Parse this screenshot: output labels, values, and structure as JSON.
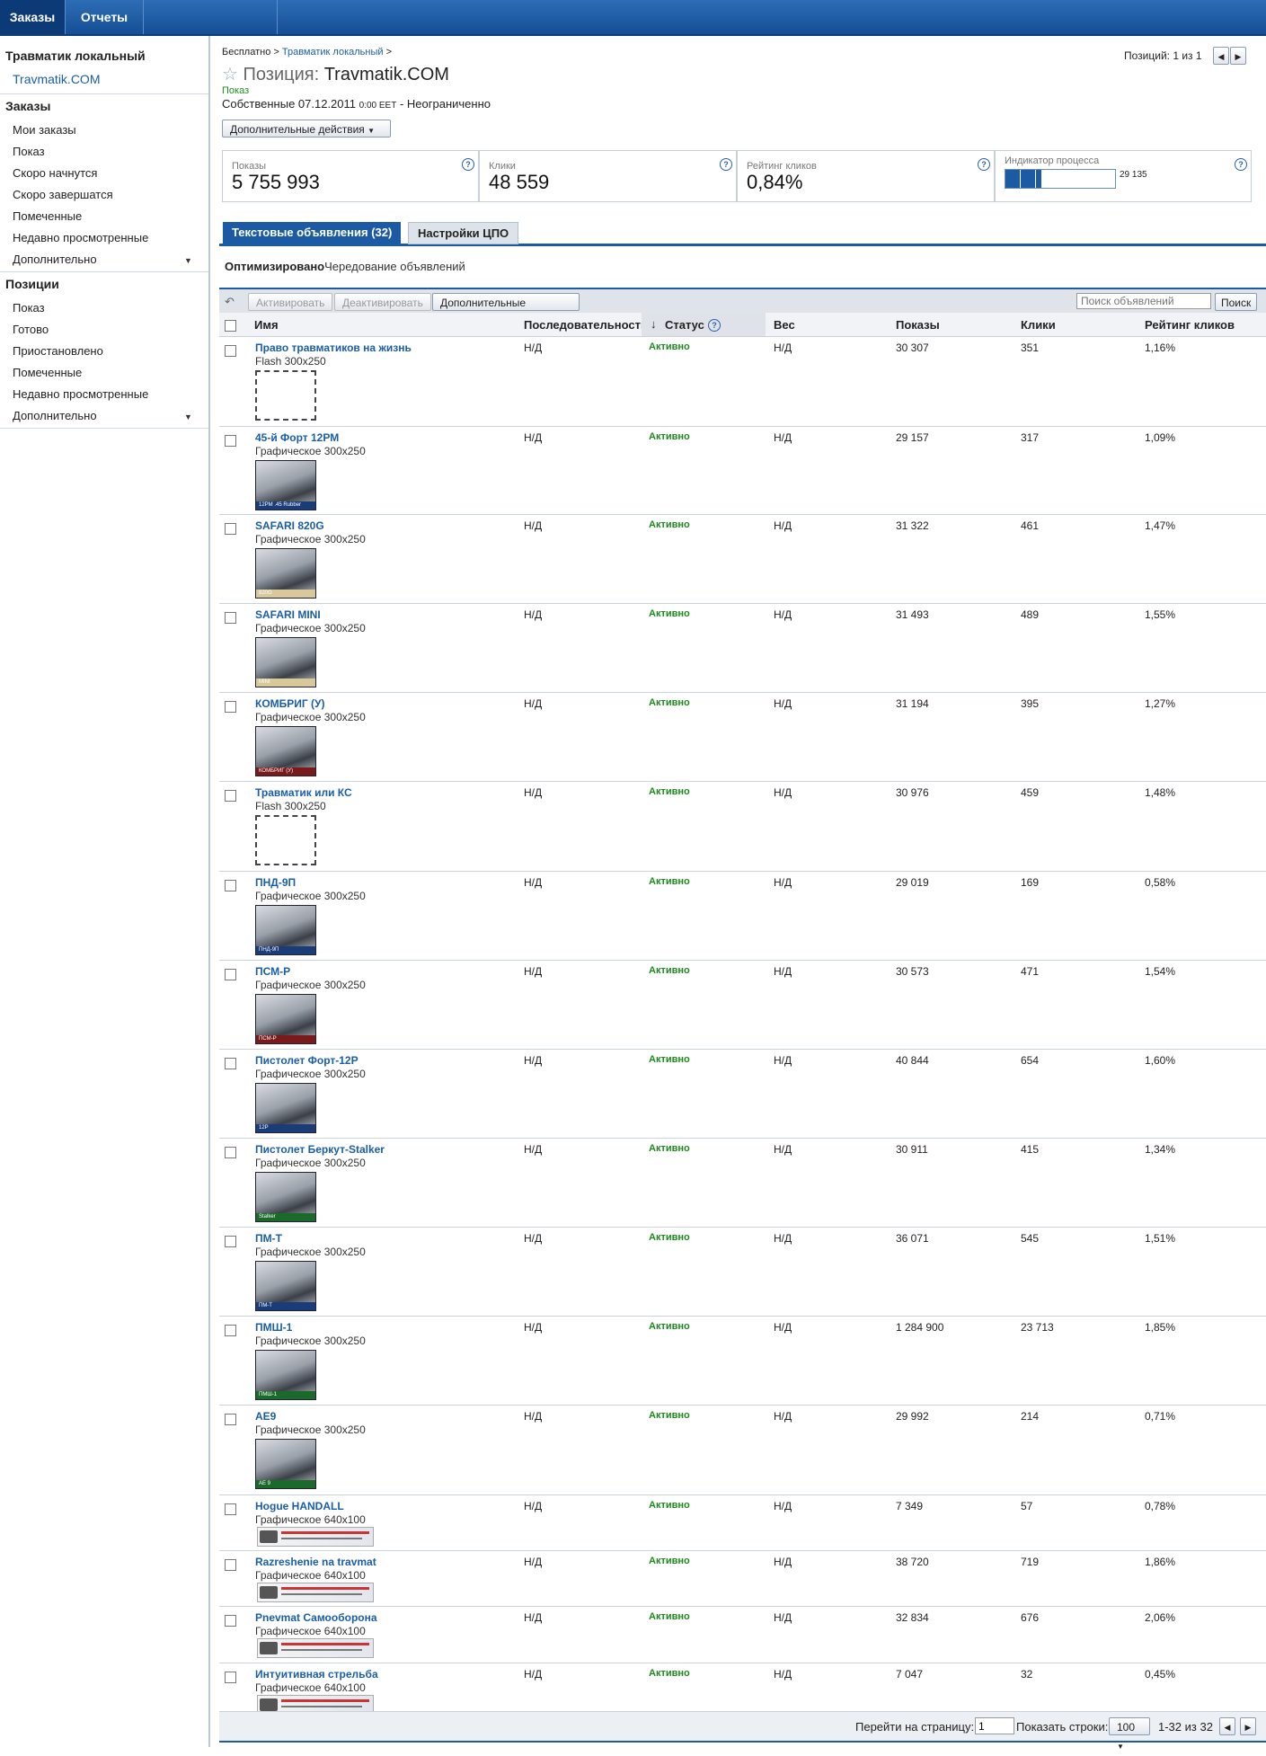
{
  "topnav": {
    "tabs": [
      "Заказы",
      "Отчеты"
    ]
  },
  "sidebar": {
    "account_title": "Травматик локальный",
    "account_link": "Travmatik.COM",
    "orders_header": "Заказы",
    "orders_items": [
      "Мои заказы",
      "Показ",
      "Скоро начнутся",
      "Скоро завершатся",
      "Помеченные",
      "Недавно просмотренные",
      "Дополнительно"
    ],
    "positions_header": "Позиции",
    "positions_items": [
      "Показ",
      "Готово",
      "Приостановлено",
      "Помеченные",
      "Недавно просмотренные",
      "Дополнительно"
    ]
  },
  "header": {
    "breadcrumb_1": "Бесплатно >",
    "breadcrumb_2": "Травматик локальный",
    "breadcrumb_sep": ">",
    "title_prefix": "Позиция:",
    "title_name": "Travmatik.COM",
    "status": "Показ",
    "dates_main": "Собственные 07.12.2011",
    "dates_time": "0:00 EET",
    "dates_end": "- Неограниченно",
    "more_actions": "Дополнительные действия",
    "pager_text": "Позиций: 1 из 1"
  },
  "stats": [
    {
      "label": "Показы",
      "value": "5 755 993"
    },
    {
      "label": "Клики",
      "value": "48 559"
    },
    {
      "label": "Рейтинг кликов",
      "value": "0,84%"
    },
    {
      "label": "Индикатор процесса",
      "value": "29 135",
      "progress": 0.33
    }
  ],
  "tabs": [
    "Текстовые объявления (32)",
    "Настройки ЦПО"
  ],
  "rotation": {
    "bold": "Оптимизировано",
    "rest": "Чередование объявлений"
  },
  "toolbar": {
    "activate": "Активировать",
    "deactivate": "Деактивировать",
    "more": "Дополнительные действия",
    "search_placeholder": "Поиск объявлений",
    "search_button": "Поиск"
  },
  "columns": [
    "Имя",
    "Последовательность",
    "Статус",
    "Вес",
    "Показы",
    "Клики",
    "Рейтинг кликов"
  ],
  "ads": [
    {
      "name": "Право травматиков на жизнь",
      "type": "Flash 300x250",
      "thumb": "dash",
      "caption": "",
      "seq": "Н/Д",
      "status": "Активно",
      "weight": "Н/Д",
      "impressions": "30 307",
      "clicks": "351",
      "ctr": "1,16%"
    },
    {
      "name": "45-й Форт 12РМ",
      "type": "Графическое 300x250",
      "thumb": "img",
      "caption": "12PM .45 Rubber",
      "strip": "#1a3d7a",
      "seq": "Н/Д",
      "status": "Активно",
      "weight": "Н/Д",
      "impressions": "29 157",
      "clicks": "317",
      "ctr": "1,09%"
    },
    {
      "name": "SAFARI 820G",
      "type": "Графическое 300x250",
      "thumb": "img",
      "caption": "820G",
      "strip": "#d9c99a",
      "seq": "Н/Д",
      "status": "Активно",
      "weight": "Н/Д",
      "impressions": "31 322",
      "clicks": "461",
      "ctr": "1,47%"
    },
    {
      "name": "SAFARI MINI",
      "type": "Графическое 300x250",
      "thumb": "img",
      "caption": "MINI",
      "strip": "#d9c99a",
      "seq": "Н/Д",
      "status": "Активно",
      "weight": "Н/Д",
      "impressions": "31 493",
      "clicks": "489",
      "ctr": "1,55%"
    },
    {
      "name": "КОМБРИГ (У)",
      "type": "Графическое 300x250",
      "thumb": "img",
      "caption": "КОМБРИГ (У)",
      "strip": "#7a1a1a",
      "seq": "Н/Д",
      "status": "Активно",
      "weight": "Н/Д",
      "impressions": "31 194",
      "clicks": "395",
      "ctr": "1,27%"
    },
    {
      "name": "Травматик или КС",
      "type": "Flash 300x250",
      "thumb": "dash",
      "caption": "",
      "seq": "Н/Д",
      "status": "Активно",
      "weight": "Н/Д",
      "impressions": "30 976",
      "clicks": "459",
      "ctr": "1,48%"
    },
    {
      "name": "ПНД-9П",
      "type": "Графическое 300x250",
      "thumb": "img",
      "caption": "ПНД-9П",
      "strip": "#1a3d7a",
      "seq": "Н/Д",
      "status": "Активно",
      "weight": "Н/Д",
      "impressions": "29 019",
      "clicks": "169",
      "ctr": "0,58%"
    },
    {
      "name": "ПСМ-Р",
      "type": "Графическое 300x250",
      "thumb": "img",
      "caption": "ПСМ-Р",
      "strip": "#7a1a1a",
      "seq": "Н/Д",
      "status": "Активно",
      "weight": "Н/Д",
      "impressions": "30 573",
      "clicks": "471",
      "ctr": "1,54%"
    },
    {
      "name": "Пистолет Форт-12Р",
      "type": "Графическое 300x250",
      "thumb": "img",
      "caption": "12P",
      "strip": "#1a3d7a",
      "seq": "Н/Д",
      "status": "Активно",
      "weight": "Н/Д",
      "impressions": "40 844",
      "clicks": "654",
      "ctr": "1,60%"
    },
    {
      "name": "Пистолет Беркут-Stalker",
      "type": "Графическое 300x250",
      "thumb": "img",
      "caption": "Stalker",
      "strip": "#1a6a2a",
      "seq": "Н/Д",
      "status": "Активно",
      "weight": "Н/Д",
      "impressions": "30 911",
      "clicks": "415",
      "ctr": "1,34%"
    },
    {
      "name": "ПМ-Т",
      "type": "Графическое 300x250",
      "thumb": "img",
      "caption": "ПМ-Т",
      "strip": "#1a3d7a",
      "seq": "Н/Д",
      "status": "Активно",
      "weight": "Н/Д",
      "impressions": "36 071",
      "clicks": "545",
      "ctr": "1,51%"
    },
    {
      "name": "ПМШ-1",
      "type": "Графическое 300x250",
      "thumb": "img",
      "caption": "ПМШ-1",
      "strip": "#1a6a2a",
      "seq": "Н/Д",
      "status": "Активно",
      "weight": "Н/Д",
      "impressions": "1 284 900",
      "clicks": "23 713",
      "ctr": "1,85%"
    },
    {
      "name": "AE9",
      "type": "Графическое 300x250",
      "thumb": "img",
      "caption": "AE 9",
      "strip": "#1a6a2a",
      "seq": "Н/Д",
      "status": "Активно",
      "weight": "Н/Д",
      "impressions": "29 992",
      "clicks": "214",
      "ctr": "0,71%"
    },
    {
      "name": "Hogue HANDALL",
      "type": "Графическое 640x100",
      "thumb": "banner",
      "caption": "",
      "seq": "Н/Д",
      "status": "Активно",
      "weight": "Н/Д",
      "impressions": "7 349",
      "clicks": "57",
      "ctr": "0,78%"
    },
    {
      "name": "Razreshenie na travmat",
      "type": "Графическое 640x100",
      "thumb": "banner",
      "caption": "",
      "seq": "Н/Д",
      "status": "Активно",
      "weight": "Н/Д",
      "impressions": "38 720",
      "clicks": "719",
      "ctr": "1,86%"
    },
    {
      "name": "Pnevmat Самооборона",
      "type": "Графическое 640x100",
      "thumb": "banner",
      "caption": "",
      "seq": "Н/Д",
      "status": "Активно",
      "weight": "Н/Д",
      "impressions": "32 834",
      "clicks": "676",
      "ctr": "2,06%"
    },
    {
      "name": "Интуитивная стрельба",
      "type": "Графическое 640x100",
      "thumb": "banner",
      "caption": "",
      "seq": "Н/Д",
      "status": "Активно",
      "weight": "Н/Д",
      "impressions": "7 047",
      "clicks": "32",
      "ctr": "0,45%"
    }
  ],
  "footer": {
    "goto_label": "Перейти на страницу:",
    "goto_value": "1",
    "rows_label": "Показать строки:",
    "rows_value": "100",
    "range": "1-32 из 32"
  }
}
